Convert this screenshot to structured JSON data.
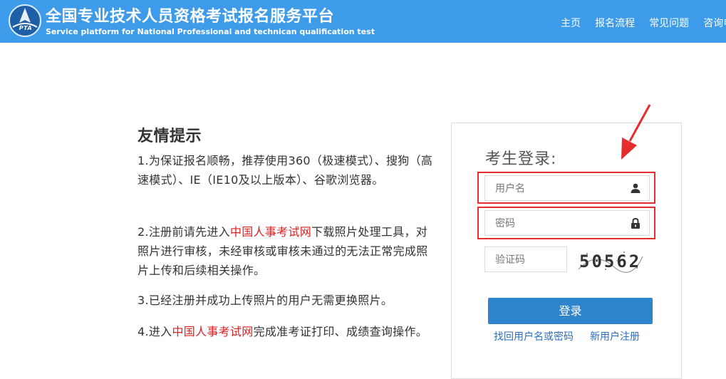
{
  "header": {
    "logo_text": "PTA",
    "title_cn": "全国专业技术人员资格考试报名服务平台",
    "title_en": "Service platform for National Professional and technican qualification test",
    "nav": [
      "主页",
      "报名流程",
      "常见问题",
      "咨询电话"
    ]
  },
  "tips": {
    "heading": "友情提示",
    "item1": "1.为保证报名顺畅，推荐使用360（极速模式）、搜狗（高速模式）、IE（IE10及以上版本）、谷歌浏览器。",
    "item2_before": "2.注册前请先进入",
    "item2_link": "中国人事考试网",
    "item2_after": "下载照片处理工具，对照片进行审核，未经审核或审核未通过的无法正常完成照片上传和后续相关操作。",
    "item3": "3.已经注册并成功上传照片的用户无需更换照片。",
    "item4_before": "4.进入",
    "item4_link": "中国人事考试网",
    "item4_after": "完成准考证打印、成绩查询操作。"
  },
  "login": {
    "title": "考生登录:",
    "username_placeholder": "用户名",
    "password_placeholder": "密码",
    "captcha_placeholder": "验证码",
    "captcha_value": "50562",
    "submit_label": "登录",
    "forgot_link": "找回用户名或密码",
    "register_link": "新用户注册"
  },
  "colors": {
    "header_bg": "#3d9be9",
    "button_bg": "#2e85cc",
    "highlight": "#e52d2d",
    "link": "#2a6fbf"
  }
}
